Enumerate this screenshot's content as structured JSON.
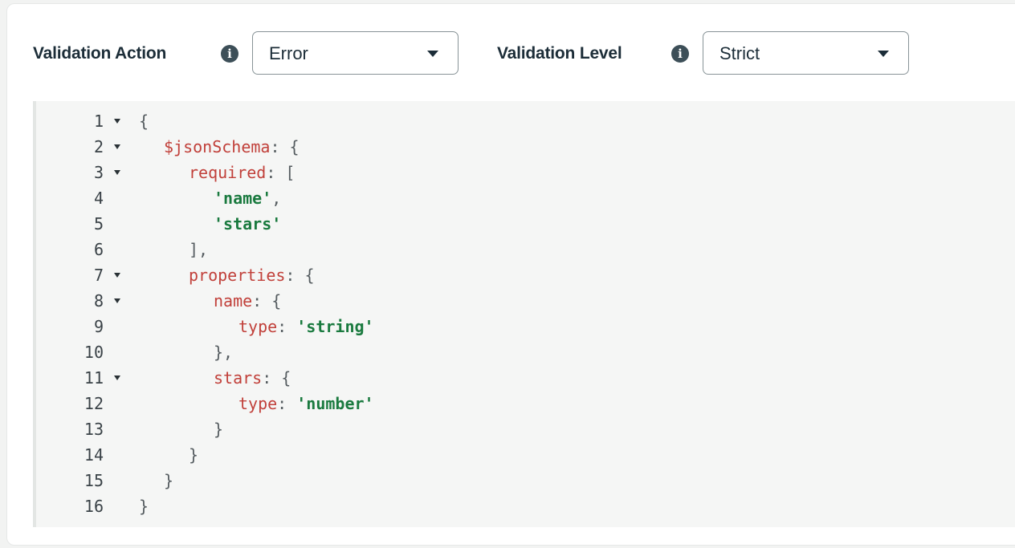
{
  "validation_action": {
    "label": "Validation Action",
    "info_icon": "info-icon",
    "selected": "Error"
  },
  "validation_level": {
    "label": "Validation Level",
    "info_icon": "info-icon",
    "selected": "Strict"
  },
  "editor": {
    "lines": [
      {
        "number": "1",
        "foldable": true,
        "indent": 0,
        "tokens": [
          {
            "t": "{",
            "c": "p"
          }
        ]
      },
      {
        "number": "2",
        "foldable": true,
        "indent": 1,
        "tokens": [
          {
            "t": "$jsonSchema",
            "c": "k"
          },
          {
            "t": ": {",
            "c": "p"
          }
        ]
      },
      {
        "number": "3",
        "foldable": true,
        "indent": 2,
        "tokens": [
          {
            "t": "required",
            "c": "k"
          },
          {
            "t": ": [",
            "c": "p"
          }
        ]
      },
      {
        "number": "4",
        "foldable": false,
        "indent": 3,
        "tokens": [
          {
            "t": "'name'",
            "c": "s"
          },
          {
            "t": ",",
            "c": "p"
          }
        ]
      },
      {
        "number": "5",
        "foldable": false,
        "indent": 3,
        "tokens": [
          {
            "t": "'stars'",
            "c": "s"
          }
        ]
      },
      {
        "number": "6",
        "foldable": false,
        "indent": 2,
        "tokens": [
          {
            "t": "],",
            "c": "p"
          }
        ]
      },
      {
        "number": "7",
        "foldable": true,
        "indent": 2,
        "tokens": [
          {
            "t": "properties",
            "c": "k"
          },
          {
            "t": ": {",
            "c": "p"
          }
        ]
      },
      {
        "number": "8",
        "foldable": true,
        "indent": 3,
        "tokens": [
          {
            "t": "name",
            "c": "k"
          },
          {
            "t": ": {",
            "c": "p"
          }
        ]
      },
      {
        "number": "9",
        "foldable": false,
        "indent": 4,
        "tokens": [
          {
            "t": "type",
            "c": "k"
          },
          {
            "t": ": ",
            "c": "p"
          },
          {
            "t": "'string'",
            "c": "s"
          }
        ]
      },
      {
        "number": "10",
        "foldable": false,
        "indent": 3,
        "tokens": [
          {
            "t": "},",
            "c": "p"
          }
        ]
      },
      {
        "number": "11",
        "foldable": true,
        "indent": 3,
        "tokens": [
          {
            "t": "stars",
            "c": "k"
          },
          {
            "t": ": {",
            "c": "p"
          }
        ]
      },
      {
        "number": "12",
        "foldable": false,
        "indent": 4,
        "tokens": [
          {
            "t": "type",
            "c": "k"
          },
          {
            "t": ": ",
            "c": "p"
          },
          {
            "t": "'number'",
            "c": "s"
          }
        ]
      },
      {
        "number": "13",
        "foldable": false,
        "indent": 3,
        "tokens": [
          {
            "t": "}",
            "c": "p"
          }
        ]
      },
      {
        "number": "14",
        "foldable": false,
        "indent": 2,
        "tokens": [
          {
            "t": "}",
            "c": "p"
          }
        ]
      },
      {
        "number": "15",
        "foldable": false,
        "indent": 1,
        "tokens": [
          {
            "t": "}",
            "c": "p"
          }
        ]
      },
      {
        "number": "16",
        "foldable": false,
        "indent": 0,
        "tokens": [
          {
            "t": "}",
            "c": "p"
          }
        ]
      }
    ],
    "colors": {
      "key": "#c1403a",
      "string": "#1a7a3f",
      "punctuation": "#555c60",
      "line_number": "#3a4247",
      "background": "#f5f6f5"
    }
  }
}
